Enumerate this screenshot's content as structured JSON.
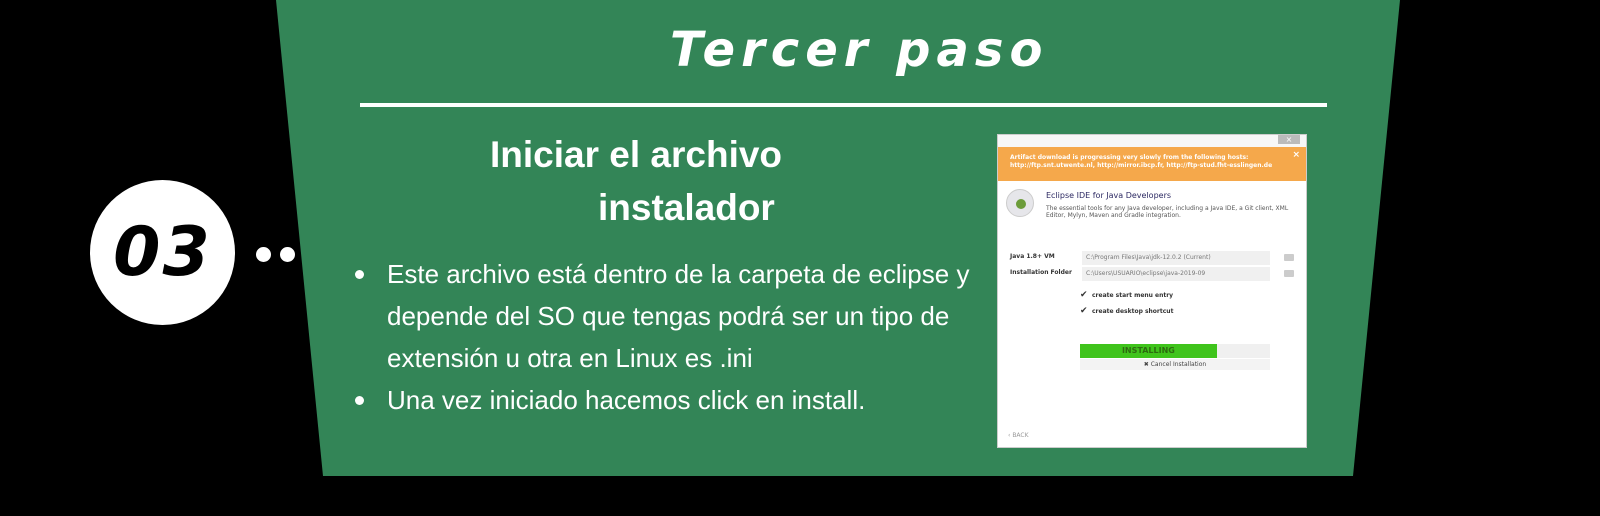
{
  "header": {
    "title": "Tercer paso"
  },
  "step": {
    "number": "03"
  },
  "content": {
    "subtitle_line1": "Iniciar el archivo",
    "subtitle_line2": "instalador",
    "bullets": [
      "Este archivo está dentro de la carpeta de eclipse y depende del SO que tengas podrá ser un tipo de extensión u otra en Linux es .ini",
      "Una vez iniciado hacemos click en install."
    ]
  },
  "installer": {
    "window_button": "×",
    "warning": "Artifact download is progressing very slowly from the following hosts: http://ftp.snt.utwente.nl, http://mirror.ibcp.fr, http://ftp-stud.fht-esslingen.de",
    "warning_close": "×",
    "product_title": "Eclipse IDE for Java Developers",
    "product_desc": "The essential tools for any Java developer, including a Java IDE, a Git client, XML Editor, Mylyn, Maven and Gradle integration.",
    "java_label": "Java 1.8+ VM",
    "java_value": "C:\\Program Files\\Java\\jdk-12.0.2 (Current)",
    "folder_label": "Installation Folder",
    "folder_value": "C:\\Users\\USUARIO\\eclipse\\java-2019-09",
    "check1": "create start menu entry",
    "check2": "create desktop shortcut",
    "progress_label": "INSTALLING",
    "progress_fraction": 0.72,
    "cancel_label": "Cancel Installation",
    "back_label": "BACK"
  },
  "colors": {
    "panel": "#338557",
    "background": "#000000",
    "progress": "#3fc41c",
    "warning": "#f5a84b"
  }
}
